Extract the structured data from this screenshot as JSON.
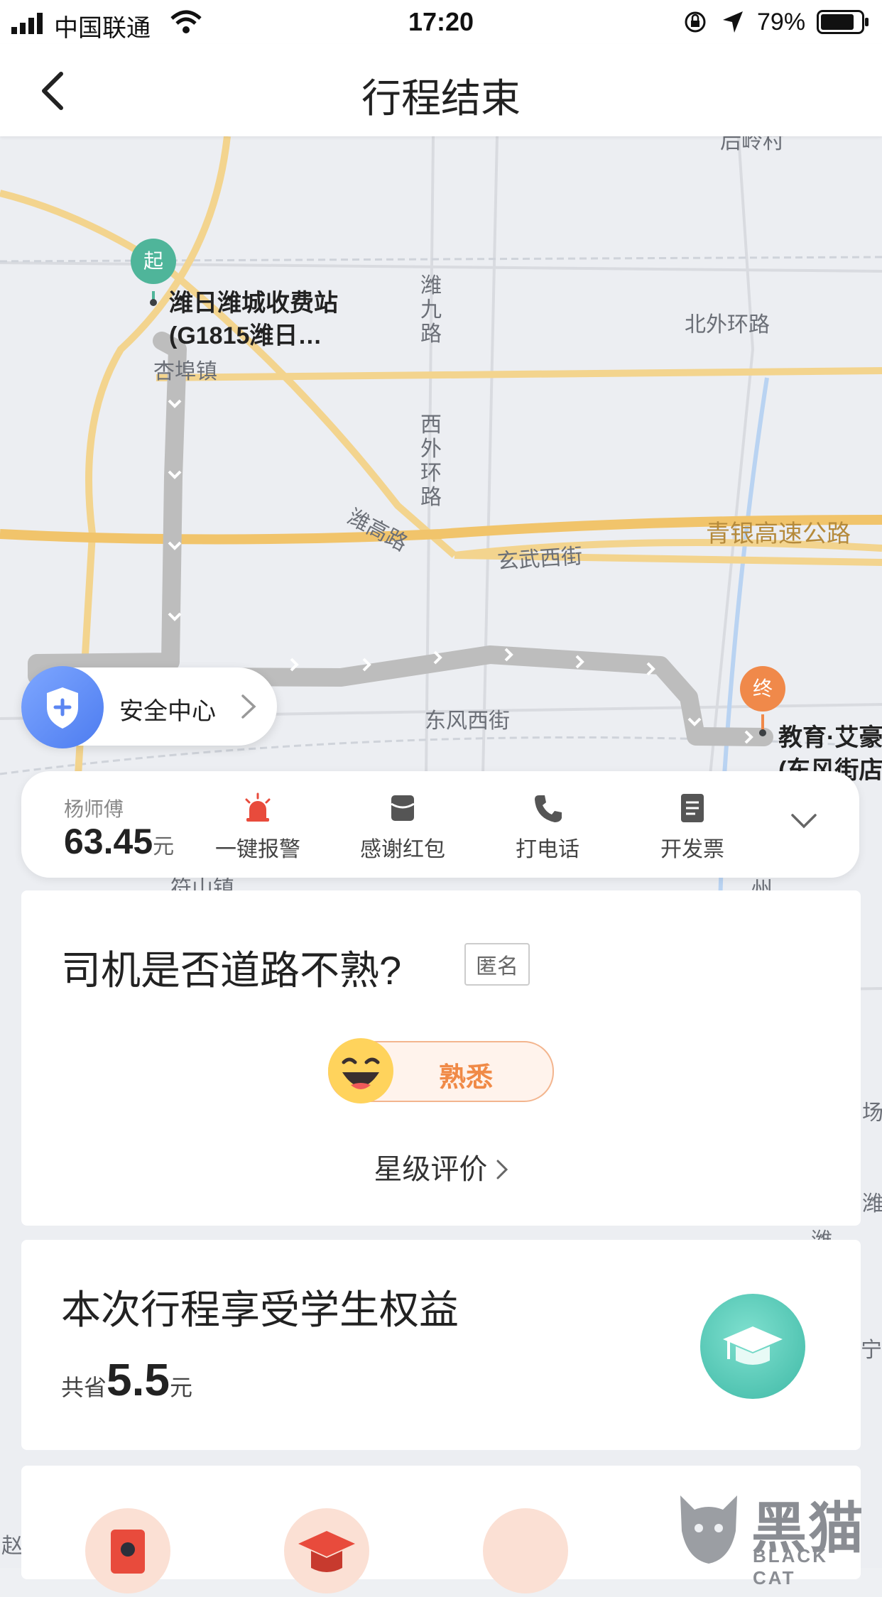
{
  "status_bar": {
    "carrier": "中国联通",
    "time": "17:20",
    "battery_percent": "79%"
  },
  "nav": {
    "title": "行程结束",
    "back_icon": "chevron-left-icon"
  },
  "map": {
    "start_marker": "起",
    "end_marker": "终",
    "start_place_line1": "潍日潍城收费站",
    "start_place_line2": "(G1815潍日…",
    "end_place_line1": "教育·艾豪",
    "end_place_line2": "(东风街店",
    "labels": {
      "xingfuzhen": "杏埠镇",
      "weijiulu": "潍九路",
      "beiwaihuanlu": "北外环路",
      "xiwaihuanlu": "西外环路",
      "weigaolu": "潍高路",
      "qingyin": "青银高速公路",
      "xuanwuxijie": "玄武西街",
      "dongfengxijie": "东风西街",
      "cunshanzhen": "符山镇",
      "top_cut": "后岭村",
      "right_chang": "场",
      "right_wei": "潍",
      "right_wei2": "潍",
      "right_ning": "宁",
      "right_zhou": "州",
      "left_zhao": "赵"
    }
  },
  "safety": {
    "label": "安全中心",
    "icon": "shield-plus-icon"
  },
  "trip_bar": {
    "driver": "杨师傅",
    "price": "63.45",
    "price_unit": "元",
    "actions": [
      {
        "label": "一键报警",
        "icon": "alarm-siren-icon",
        "color": "#e84b3c"
      },
      {
        "label": "感谢红包",
        "icon": "red-envelope-icon",
        "color": "#555555"
      },
      {
        "label": "打电话",
        "icon": "phone-icon",
        "color": "#555555"
      },
      {
        "label": "开发票",
        "icon": "invoice-icon",
        "color": "#555555"
      }
    ],
    "expand_icon": "chevron-down-icon"
  },
  "rating": {
    "question": "司机是否道路不熟?",
    "anonymous": "匿名",
    "choice": "熟悉",
    "choice_icon": "laughing-face-icon",
    "star_rating": "星级评价"
  },
  "student": {
    "title": "本次行程享受学生权益",
    "save_prefix": "共省",
    "save_amount": "5.5",
    "save_unit": "元",
    "icon": "graduation-cap-icon"
  },
  "watermark": {
    "text_cn": "黑猫",
    "text_en": "BLACK CAT"
  },
  "colors": {
    "accent_orange": "#f08a47",
    "start_pin": "#4fb59a",
    "end_pin": "#f0894a",
    "route": "#bfbfbf",
    "road_yellow": "#f1c46b"
  }
}
